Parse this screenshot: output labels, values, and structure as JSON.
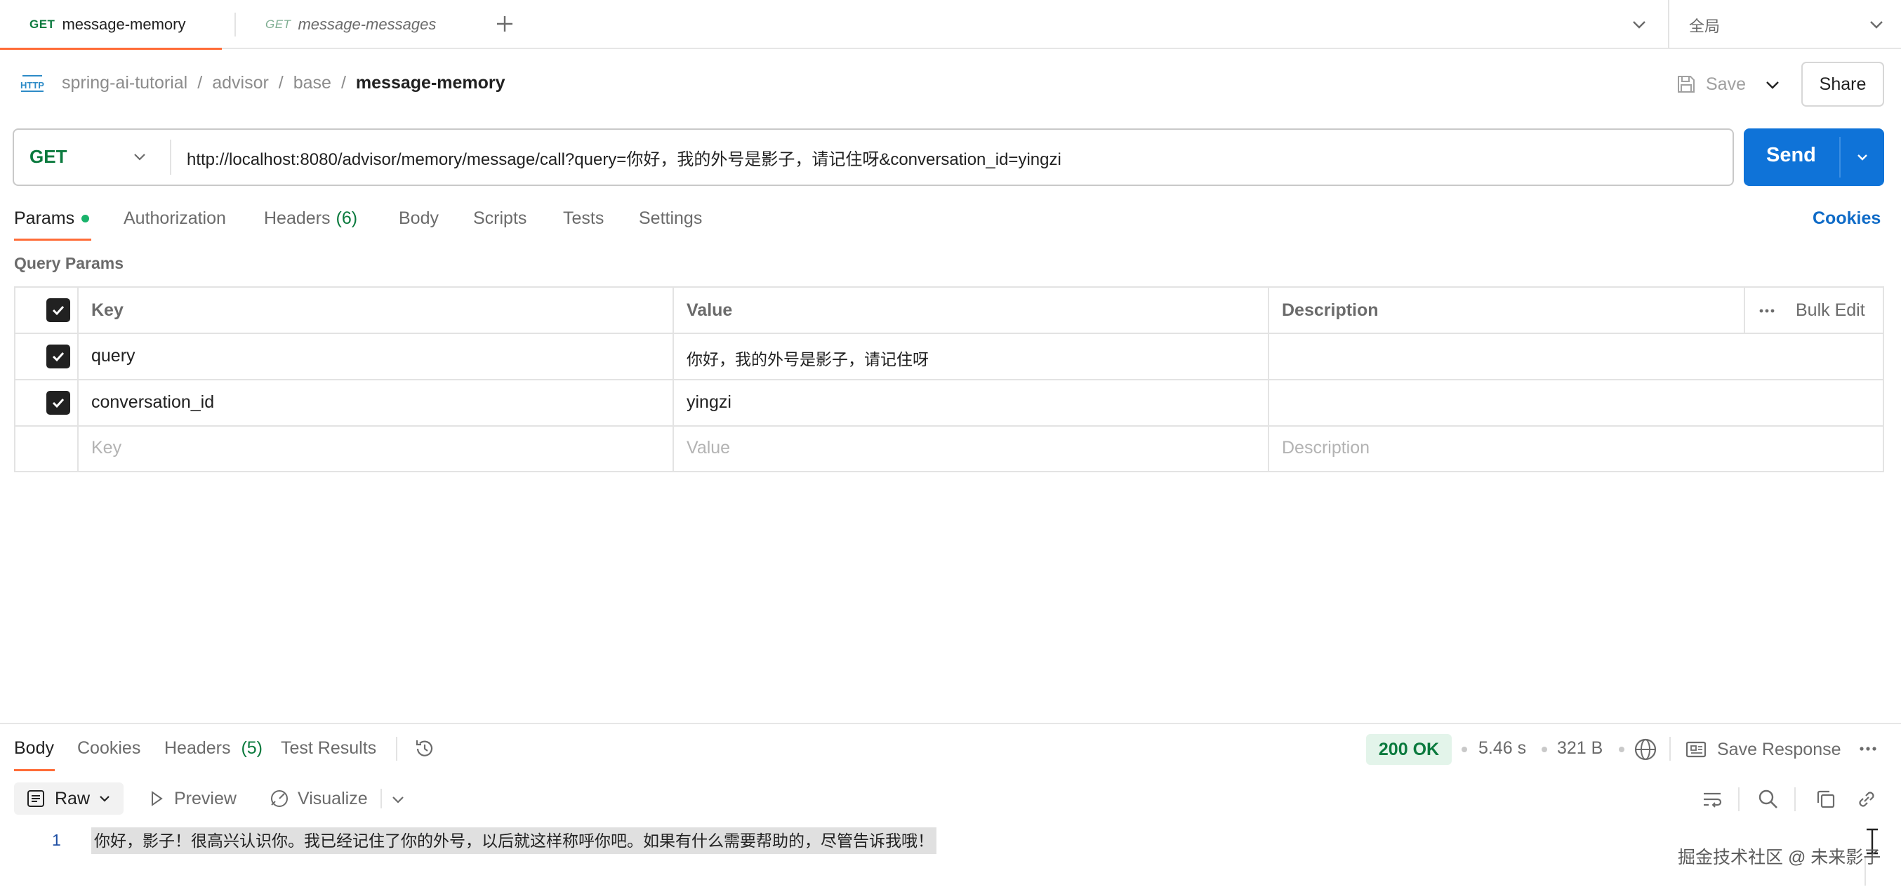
{
  "tabs": [
    {
      "method": "GET",
      "name": "message-memory",
      "active": true
    },
    {
      "method": "GET",
      "name": "message-messages",
      "active": false
    }
  ],
  "environment": {
    "label": "全局"
  },
  "breadcrumb": {
    "icon_label": "HTTP",
    "items": [
      "spring-ai-tutorial",
      "advisor",
      "base"
    ],
    "separator": "/",
    "current": "message-memory"
  },
  "toolbar": {
    "save_label": "Save",
    "share_label": "Share"
  },
  "request": {
    "method": "GET",
    "url": "http://localhost:8080/advisor/memory/message/call?query=你好，我的外号是影子，请记住呀&conversation_id=yingzi",
    "send_label": "Send"
  },
  "request_tabs": {
    "params": "Params",
    "authorization": "Authorization",
    "headers": "Headers",
    "headers_count": "(6)",
    "body": "Body",
    "scripts": "Scripts",
    "tests": "Tests",
    "settings": "Settings",
    "cookies": "Cookies"
  },
  "query_params": {
    "section_title": "Query Params",
    "headers": {
      "key": "Key",
      "value": "Value",
      "description": "Description",
      "bulk_edit": "Bulk Edit"
    },
    "rows": [
      {
        "checked": true,
        "key": "query",
        "value": "你好，我的外号是影子，请记住呀",
        "description": ""
      },
      {
        "checked": true,
        "key": "conversation_id",
        "value": "yingzi",
        "description": ""
      }
    ],
    "placeholders": {
      "key": "Key",
      "value": "Value",
      "description": "Description"
    }
  },
  "response": {
    "tabs": {
      "body": "Body",
      "cookies": "Cookies",
      "headers": "Headers",
      "headers_count": "(5)",
      "test_results": "Test Results"
    },
    "status": "200 OK",
    "time": "5.46 s",
    "size": "321 B",
    "save_response": "Save Response",
    "format": "Raw",
    "preview": "Preview",
    "visualize": "Visualize",
    "lines": [
      {
        "number": "1",
        "text": "你好，影子！很高兴认识你。我已经记住了你的外号，以后就这样称呼你吧。如果有什么需要帮助的，尽管告诉我哦！"
      }
    ]
  },
  "watermark": "掘金技术社区 @ 未来影子",
  "colors": {
    "accent_orange": "#ff6c37",
    "send_blue": "#0f73d8",
    "get_green": "#0b7a3e",
    "status_green_bg": "#e3f4ea",
    "status_green_text": "#0b7a3e"
  }
}
